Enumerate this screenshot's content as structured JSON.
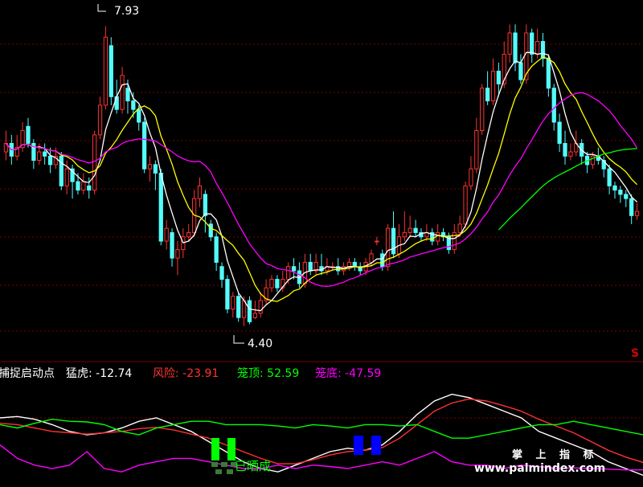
{
  "chart_data": [
    {
      "type": "candlestick",
      "title": "",
      "ylim": [
        4.0,
        8.2
      ],
      "annotations": [
        {
          "text": "7.93",
          "candle": 18,
          "price": 7.93
        },
        {
          "text": "4.40",
          "candle": 43,
          "price": 4.4
        }
      ],
      "signal_marker": "S",
      "colors": {
        "up": "#ff3232",
        "down": "#54fcfc",
        "ma_short": "#ffffff",
        "ma_mid": "#ffff00",
        "ma_long": "#ff00ff",
        "ma_xlong": "#00ff00"
      },
      "candles": [
        [
          6.45,
          6.55,
          6.7,
          6.35
        ],
        [
          6.55,
          6.4,
          6.65,
          6.3
        ],
        [
          6.4,
          6.5,
          6.65,
          6.35
        ],
        [
          6.5,
          6.7,
          6.8,
          6.45
        ],
        [
          6.75,
          6.55,
          6.85,
          6.5
        ],
        [
          6.55,
          6.35,
          6.6,
          6.25
        ],
        [
          6.35,
          6.45,
          6.55,
          6.3
        ],
        [
          6.45,
          6.4,
          6.55,
          6.3
        ],
        [
          6.4,
          6.3,
          6.5,
          6.2
        ],
        [
          6.3,
          6.4,
          6.5,
          6.25
        ],
        [
          6.4,
          6.05,
          6.45,
          6.0
        ],
        [
          6.05,
          6.25,
          6.35,
          5.95
        ],
        [
          6.25,
          6.1,
          6.3,
          5.9
        ],
        [
          6.1,
          6.0,
          6.2,
          5.95
        ],
        [
          6.0,
          6.1,
          6.2,
          5.95
        ],
        [
          6.05,
          6.0,
          6.15,
          5.9
        ],
        [
          6.0,
          6.65,
          6.7,
          5.95
        ],
        [
          6.65,
          7.0,
          7.1,
          6.6
        ],
        [
          7.0,
          7.8,
          7.93,
          6.95
        ],
        [
          7.7,
          7.1,
          7.8,
          7.0
        ],
        [
          7.1,
          6.95,
          7.3,
          6.9
        ],
        [
          6.95,
          7.35,
          7.45,
          6.9
        ],
        [
          7.2,
          7.05,
          7.3,
          6.9
        ],
        [
          7.05,
          6.95,
          7.15,
          6.85
        ],
        [
          6.95,
          6.8,
          7.0,
          6.7
        ],
        [
          6.8,
          6.25,
          6.85,
          6.2
        ],
        [
          6.25,
          6.3,
          6.4,
          6.1
        ],
        [
          6.3,
          6.2,
          6.35,
          6.0
        ],
        [
          6.2,
          5.4,
          6.25,
          5.35
        ],
        [
          5.4,
          5.55,
          5.65,
          5.3
        ],
        [
          5.5,
          5.2,
          5.55,
          5.1
        ],
        [
          5.2,
          5.3,
          5.4,
          5.0
        ],
        [
          5.3,
          5.45,
          5.55,
          5.2
        ],
        [
          5.45,
          5.5,
          5.6,
          5.4
        ],
        [
          5.5,
          5.9,
          6.0,
          5.45
        ],
        [
          5.9,
          6.05,
          6.15,
          5.8
        ],
        [
          5.95,
          5.7,
          6.0,
          5.5
        ],
        [
          5.6,
          5.45,
          5.65,
          5.4
        ],
        [
          5.45,
          5.15,
          5.5,
          5.05
        ],
        [
          5.1,
          4.95,
          5.15,
          4.85
        ],
        [
          4.95,
          4.6,
          5.0,
          4.55
        ],
        [
          4.6,
          4.75,
          4.8,
          4.5
        ],
        [
          4.75,
          4.5,
          4.8,
          4.45
        ],
        [
          4.5,
          4.7,
          4.75,
          4.4
        ],
        [
          4.7,
          4.45,
          4.75,
          4.42
        ],
        [
          4.5,
          4.55,
          4.7,
          4.48
        ],
        [
          4.55,
          4.7,
          4.8,
          4.5
        ],
        [
          4.7,
          4.85,
          4.95,
          4.65
        ],
        [
          4.85,
          4.95,
          5.0,
          4.8
        ],
        [
          4.95,
          4.85,
          5.0,
          4.8
        ],
        [
          4.85,
          4.95,
          5.05,
          4.8
        ],
        [
          4.95,
          5.1,
          5.15,
          4.9
        ],
        [
          5.1,
          5.05,
          5.2,
          4.95
        ],
        [
          5.05,
          4.9,
          5.15,
          4.85
        ],
        [
          4.9,
          5.15,
          5.25,
          4.85
        ],
        [
          5.15,
          5.05,
          5.25,
          5.0
        ],
        [
          5.05,
          5.15,
          5.25,
          5.0
        ],
        [
          5.1,
          5.05,
          5.25,
          5.0
        ],
        [
          5.05,
          5.1,
          5.2,
          5.0
        ],
        [
          5.1,
          5.1,
          5.15,
          5.05
        ],
        [
          5.1,
          5.05,
          5.2,
          5.0
        ],
        [
          5.05,
          5.1,
          5.15,
          5.0
        ],
        [
          5.1,
          5.15,
          5.2,
          5.05
        ],
        [
          5.15,
          5.1,
          5.2,
          5.05
        ],
        [
          5.1,
          5.05,
          5.15,
          5.0
        ],
        [
          5.05,
          5.15,
          5.2,
          5.0
        ],
        [
          5.15,
          5.25,
          5.3,
          5.1
        ],
        [
          5.4,
          5.4,
          5.45,
          5.35
        ],
        [
          5.25,
          5.1,
          5.3,
          5.05
        ],
        [
          5.1,
          5.55,
          5.6,
          5.05
        ],
        [
          5.55,
          5.25,
          5.75,
          5.2
        ],
        [
          5.25,
          5.45,
          5.6,
          5.2
        ],
        [
          5.45,
          5.5,
          5.75,
          5.4
        ],
        [
          5.5,
          5.55,
          5.7,
          5.45
        ],
        [
          5.55,
          5.5,
          5.65,
          5.45
        ],
        [
          5.5,
          5.45,
          5.55,
          5.4
        ],
        [
          5.45,
          5.5,
          5.6,
          5.4
        ],
        [
          5.5,
          5.4,
          5.55,
          5.35
        ],
        [
          5.4,
          5.5,
          5.6,
          5.35
        ],
        [
          5.5,
          5.45,
          5.55,
          5.4
        ],
        [
          5.45,
          5.3,
          5.5,
          5.25
        ],
        [
          5.3,
          5.5,
          5.6,
          5.25
        ],
        [
          5.5,
          5.6,
          5.7,
          5.45
        ],
        [
          5.6,
          6.05,
          6.1,
          5.55
        ],
        [
          6.05,
          6.25,
          6.4,
          6.0
        ],
        [
          6.25,
          6.7,
          6.85,
          6.2
        ],
        [
          6.7,
          7.2,
          7.25,
          6.65
        ],
        [
          7.2,
          7.05,
          7.4,
          7.0
        ],
        [
          7.05,
          7.4,
          7.55,
          7.0
        ],
        [
          7.4,
          7.25,
          7.5,
          7.1
        ],
        [
          7.25,
          7.6,
          7.75,
          7.2
        ],
        [
          7.6,
          7.85,
          7.95,
          7.5
        ],
        [
          7.85,
          7.5,
          7.95,
          7.4
        ],
        [
          7.5,
          7.3,
          7.6,
          7.25
        ],
        [
          7.3,
          7.85,
          7.95,
          7.25
        ],
        [
          7.85,
          7.6,
          7.9,
          7.5
        ],
        [
          7.6,
          7.75,
          7.9,
          7.55
        ],
        [
          7.75,
          7.55,
          7.85,
          7.45
        ],
        [
          7.55,
          7.2,
          7.6,
          7.1
        ],
        [
          7.2,
          6.8,
          7.25,
          6.7
        ],
        [
          6.8,
          6.55,
          6.9,
          6.45
        ],
        [
          6.55,
          6.4,
          6.7,
          6.3
        ],
        [
          6.4,
          6.45,
          6.55,
          6.35
        ],
        [
          6.45,
          6.55,
          6.7,
          6.4
        ],
        [
          6.55,
          6.4,
          6.6,
          6.3
        ],
        [
          6.4,
          6.3,
          6.45,
          6.2
        ],
        [
          6.3,
          6.4,
          6.45,
          6.25
        ],
        [
          6.4,
          6.35,
          6.5,
          6.3
        ],
        [
          6.35,
          6.25,
          6.4,
          6.15
        ],
        [
          6.25,
          6.05,
          6.3,
          5.95
        ],
        [
          6.05,
          6.0,
          6.1,
          5.9
        ],
        [
          6.0,
          5.95,
          6.05,
          5.85
        ],
        [
          5.95,
          5.9,
          6.0,
          5.8
        ],
        [
          5.9,
          5.7,
          5.95,
          5.6
        ],
        [
          5.7,
          5.75,
          5.85,
          5.65
        ]
      ]
    },
    {
      "type": "line",
      "title": "捕捉启动点",
      "legend": [
        {
          "label": "猛虎:",
          "value": "-12.74",
          "label_color": "#ffffff",
          "value_color": "#ffffff"
        },
        {
          "label": "风险:",
          "value": "-23.91",
          "label_color": "#ff3232",
          "value_color": "#ff3232"
        },
        {
          "label": "笼顶:",
          "value": "52.59",
          "label_color": "#00ff00",
          "value_color": "#00ff00"
        },
        {
          "label": "笼底:",
          "value": "-47.59",
          "label_color": "#ff00ff",
          "value_color": "#ff00ff"
        }
      ],
      "ylim": [
        -70,
        80
      ],
      "series": [
        {
          "name": "猛虎",
          "color": "#ffffff",
          "values": [
            30,
            32,
            28,
            20,
            10,
            5,
            8,
            15,
            25,
            30,
            20,
            10,
            -5,
            -20,
            -35,
            -45,
            -50,
            -40,
            -30,
            -20,
            -15,
            -18,
            -10,
            10,
            35,
            55,
            65,
            60,
            50,
            40,
            30,
            10,
            0,
            -10,
            -20,
            -35,
            -45,
            -55
          ]
        },
        {
          "name": "风险",
          "color": "#ff3232",
          "values": [
            22,
            20,
            15,
            10,
            8,
            6,
            8,
            10,
            14,
            16,
            12,
            6,
            0,
            -10,
            -20,
            -30,
            -38,
            -38,
            -32,
            -25,
            -20,
            -18,
            -14,
            0,
            20,
            40,
            52,
            58,
            55,
            48,
            40,
            28,
            18,
            8,
            -5,
            -18,
            -28,
            -36
          ]
        },
        {
          "name": "笼顶",
          "color": "#00ff00",
          "values": [
            20,
            15,
            22,
            28,
            25,
            24,
            20,
            10,
            5,
            15,
            20,
            25,
            25,
            20,
            20,
            20,
            18,
            15,
            20,
            18,
            15,
            20,
            20,
            18,
            20,
            10,
            0,
            0,
            5,
            10,
            15,
            20,
            20,
            25,
            20,
            15,
            10,
            5
          ]
        },
        {
          "name": "笼底",
          "color": "#ff00ff",
          "values": [
            -10,
            -30,
            -40,
            -45,
            -40,
            -20,
            -45,
            -50,
            -40,
            -35,
            -30,
            -30,
            -35,
            -40,
            -45,
            -45,
            -40,
            -45,
            -40,
            -42,
            -45,
            -40,
            -35,
            -40,
            -30,
            -20,
            -35,
            -40,
            -40,
            -45,
            -40,
            -42,
            -45,
            -44,
            -45,
            -46,
            -47,
            -47
          ]
        }
      ],
      "markers": [
        {
          "text": "已晒成",
          "color": "#00ff00"
        }
      ],
      "watermark": [
        "掌 上 指 标",
        "www.palmindex.com"
      ]
    }
  ]
}
